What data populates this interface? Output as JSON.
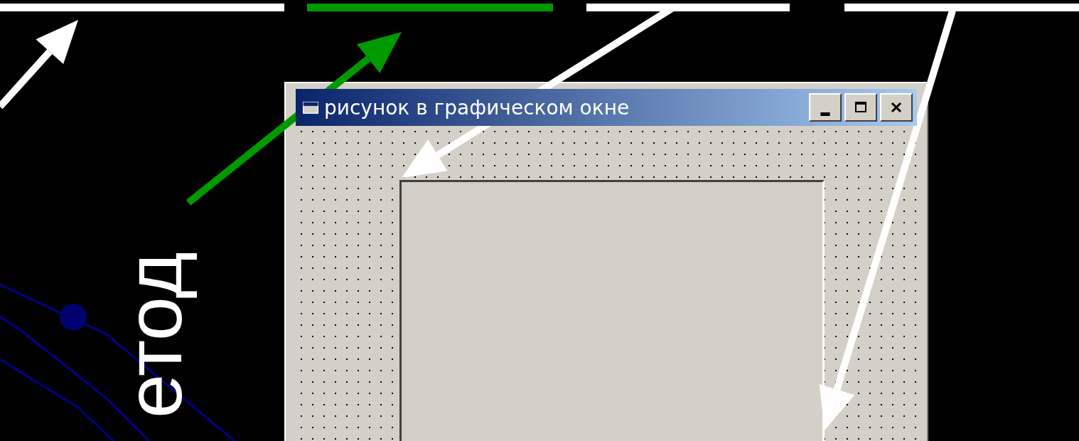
{
  "slide": {
    "blanks": [
      {
        "color": "#ffffff"
      },
      {
        "color": "#009900"
      },
      {
        "color": "#ffffff"
      },
      {
        "color": "#ffffff"
      }
    ],
    "vertical_text": "етод",
    "arrows": [
      {
        "color": "#ffffff"
      },
      {
        "color": "#009900"
      },
      {
        "color": "#ffffff"
      },
      {
        "color": "#ffffff"
      }
    ]
  },
  "window": {
    "title": "рисунок в графическом окне"
  }
}
